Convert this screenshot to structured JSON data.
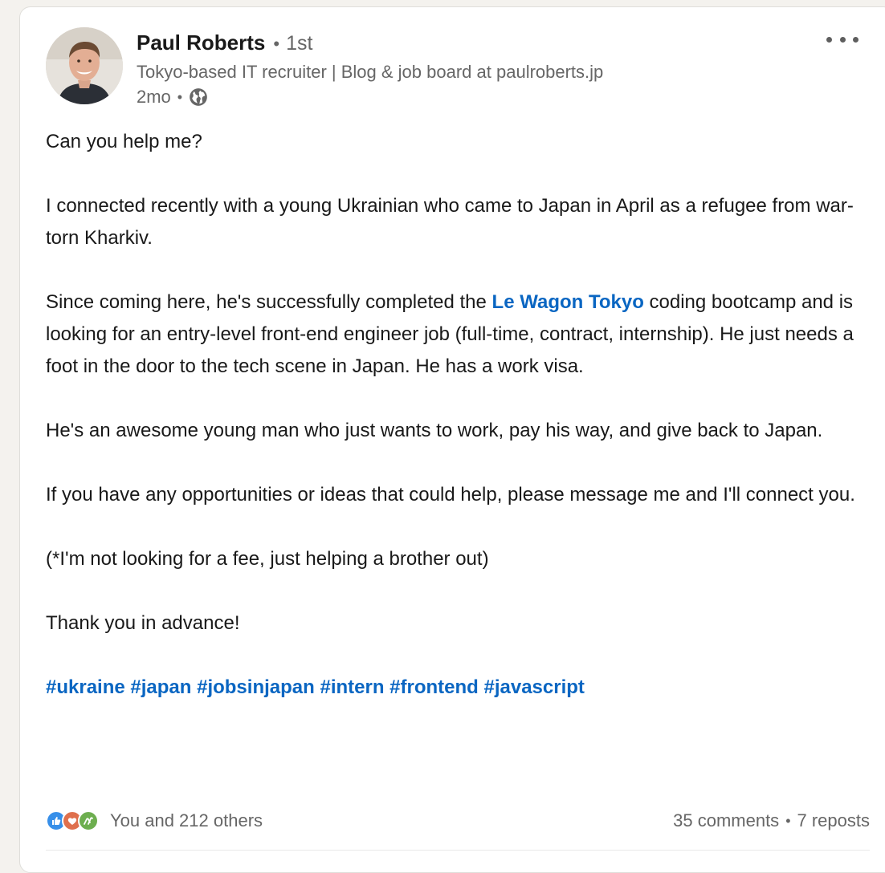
{
  "author": {
    "name": "Paul Roberts",
    "connection_degree": "1st",
    "headline": "Tokyo-based IT recruiter | Blog & job board at paulroberts.jp",
    "time_ago": "2mo",
    "visibility_icon": "globe-icon"
  },
  "post": {
    "p1": "Can you help me?",
    "p2": "I connected recently with a young Ukrainian who came to Japan in April as a refugee from war-torn Kharkiv.",
    "p3_before": "Since coming here, he's successfully completed the ",
    "p3_link": "Le Wagon Tokyo",
    "p3_after": " coding bootcamp and is looking for an entry-level front-end engineer job (full-time, contract, internship). He just needs a foot in the door to the tech scene in Japan. He has a work visa.",
    "p4": "He's an awesome young man who just wants to work, pay his way, and give back to Japan.",
    "p5": "If you have any opportunities or ideas that could help, please message me and I'll connect you.",
    "p6": "(*I'm not looking for a fee, just helping a brother out)",
    "p7": "Thank you in advance!",
    "hashtags": [
      "#ukraine",
      "#japan",
      "#jobsinjapan",
      "#intern",
      "#frontend",
      "#javascript"
    ]
  },
  "social": {
    "reaction_icons": [
      "like-icon",
      "love-icon",
      "support-icon"
    ],
    "reactions_text": "You and 212 others",
    "comments": "35 comments",
    "reposts": "7 reposts"
  },
  "colors": {
    "link": "#0a66c2",
    "text_primary": "#191919",
    "text_secondary": "#666666",
    "like": "#378fe9",
    "love": "#df704d",
    "support": "#6dae4f"
  }
}
